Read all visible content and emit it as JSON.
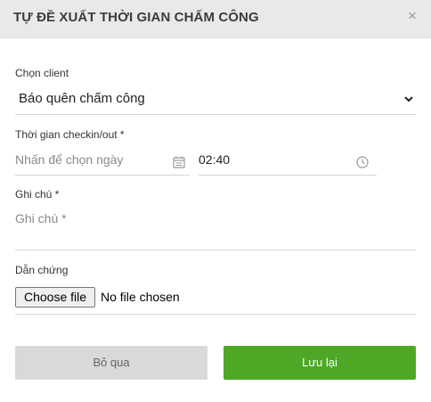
{
  "dialog": {
    "title": "TỰ ĐỀ XUẤT THỜI GIAN CHẤM CÔNG",
    "close_symbol": "×"
  },
  "form": {
    "client": {
      "label": "Chọn client",
      "value": "Báo quên chấm công"
    },
    "checkin": {
      "label": "Thời gian checkin/out *",
      "date_placeholder": "Nhấn để chọn ngày",
      "time_value": "02:40"
    },
    "note": {
      "label": "Ghi chú *",
      "placeholder": "Ghi chú *"
    },
    "evidence": {
      "label": "Dẫn chứng",
      "choose_button": "Choose file",
      "status": "No file chosen"
    }
  },
  "actions": {
    "cancel_label": "Bỏ qua",
    "save_label": "Lưu lại"
  },
  "colors": {
    "header_bg": "#e9e9e9",
    "save_bg": "#4fa825",
    "cancel_bg": "#d9d9d9"
  },
  "icons": {
    "close": "close-icon",
    "select": "chevron-down-icon",
    "date": "calendar-icon",
    "time": "clock-icon"
  }
}
